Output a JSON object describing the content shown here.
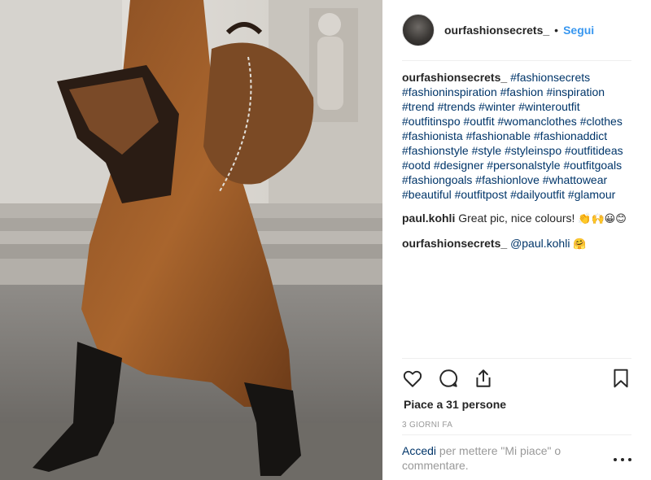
{
  "post": {
    "image_alt": "Woman in brown satin dress with brown suede bag and black heeled boots",
    "header": {
      "username": "ourfashionsecrets_",
      "separator": "•",
      "follow_label": "Segui"
    },
    "comments": [
      {
        "username": "ourfashionsecrets_",
        "text": "#fashionsecrets #fashioninspiration #fashion #inspiration #trend #trends #winter #winteroutfit #outfitinspo #outfit #womanclothes #clothes #fashionista #fashionable #fashionaddict #fashionstyle #style #styleinspo #outfitideas #ootd #designer #personalstyle #outfitgoals #fashiongoals #fashionlove #whattowear #beautiful #outfitpost #dailyoutfit #glamour"
      },
      {
        "username": "paul.kohli",
        "text": "Great pic, nice colours!",
        "emoji": "👏🙌😀😊"
      },
      {
        "username": "ourfashionsecrets_",
        "mention": "@paul.kohli",
        "emoji": "🤗"
      }
    ],
    "icons": {
      "like": "heart-icon",
      "comment": "comment-icon",
      "share": "share-icon",
      "save": "bookmark-icon",
      "more": "more-icon"
    },
    "likes_text": "Piace a 31 persone",
    "timestamp": "3 GIORNI FA",
    "login_prompt": {
      "link": "Accedi",
      "text": "per mettere \"Mi piace\" o commentare."
    }
  },
  "colors": {
    "link_blue": "#3897f0",
    "hashtag": "#003569",
    "muted": "#999999",
    "divider": "#efefef"
  }
}
